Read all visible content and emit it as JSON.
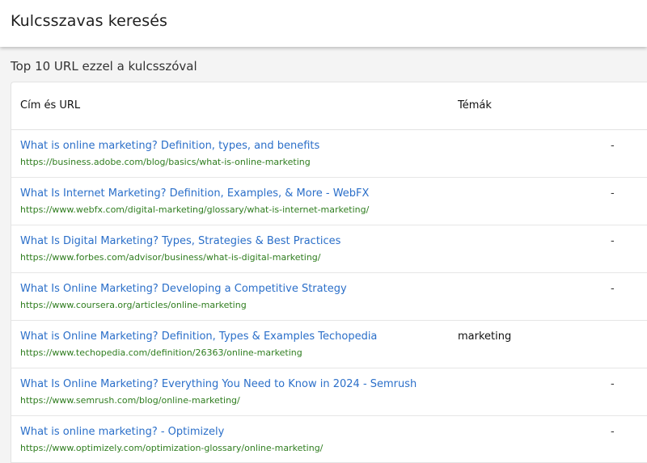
{
  "header": {
    "title": "Kulcsszavas keresés"
  },
  "section": {
    "title": "Top 10 URL ezzel a kulcsszóval"
  },
  "table": {
    "columns": {
      "title_url": "Cím és URL",
      "topics": "Témák"
    },
    "rows": [
      {
        "title": "What is online marketing? Definition, types, and benefits",
        "url": "https://business.adobe.com/blog/basics/what-is-online-marketing",
        "topic": "",
        "dash": "-"
      },
      {
        "title": "What Is Internet Marketing? Definition, Examples, & More - WebFX",
        "url": "https://www.webfx.com/digital-marketing/glossary/what-is-internet-marketing/",
        "topic": "",
        "dash": "-"
      },
      {
        "title": "What Is Digital Marketing? Types, Strategies & Best Practices",
        "url": "https://www.forbes.com/advisor/business/what-is-digital-marketing/",
        "topic": "",
        "dash": "-"
      },
      {
        "title": "What Is Online Marketing? Developing a Competitive Strategy",
        "url": "https://www.coursera.org/articles/online-marketing",
        "topic": "",
        "dash": "-"
      },
      {
        "title": "What is Online Marketing? Definition, Types & Examples Techopedia",
        "url": "https://www.techopedia.com/definition/26363/online-marketing",
        "topic": "marketing",
        "dash": ""
      },
      {
        "title": "What Is Online Marketing? Everything You Need to Know in 2024 - Semrush",
        "url": "https://www.semrush.com/blog/online-marketing/",
        "topic": "",
        "dash": "-"
      },
      {
        "title": "What is online marketing? - Optimizely",
        "url": "https://www.optimizely.com/optimization-glossary/online-marketing/",
        "topic": "",
        "dash": "-"
      }
    ]
  }
}
